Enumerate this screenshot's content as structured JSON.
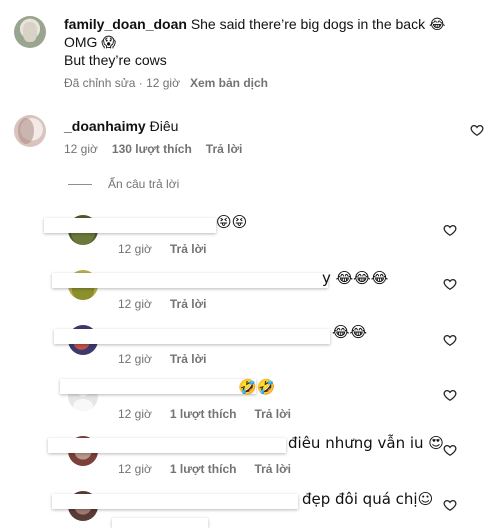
{
  "comment1": {
    "username": "family_doan_doan",
    "text_line1": "She said there’re big dogs in the back 😂",
    "text_line2": "OMG 😱",
    "text_line3": "But they’re cows",
    "edited": "Đã chỉnh sửa · 12 giờ",
    "translate": "Xem bản dịch"
  },
  "comment2": {
    "username": "_doanhaimy",
    "text": "Điêu",
    "time": "12 giờ",
    "likes": "130 lượt thích",
    "reply": "Trả lời",
    "hide_replies": "Ẩn câu trả lời"
  },
  "replies": [
    {
      "text": "😝😝",
      "time": "12 giờ",
      "likes": "",
      "reply": "Trả lời"
    },
    {
      "text": "y 😂😂😂",
      "time": "12 giờ",
      "likes": "",
      "reply": "Trả lời"
    },
    {
      "text": "😂😂",
      "time": "12 giờ",
      "likes": "",
      "reply": "Trả lời"
    },
    {
      "text": "🤣🤣",
      "time": "12 giờ",
      "likes": "1 lượt thích",
      "reply": "Trả lời"
    },
    {
      "text": "điêu nhưng vẫn iu 😍",
      "time": "12 giờ",
      "likes": "1 lượt thích",
      "reply": "Trả lời"
    },
    {
      "text": "đẹp đôi quá chị☺",
      "time": "",
      "likes": "",
      "reply": ""
    }
  ]
}
